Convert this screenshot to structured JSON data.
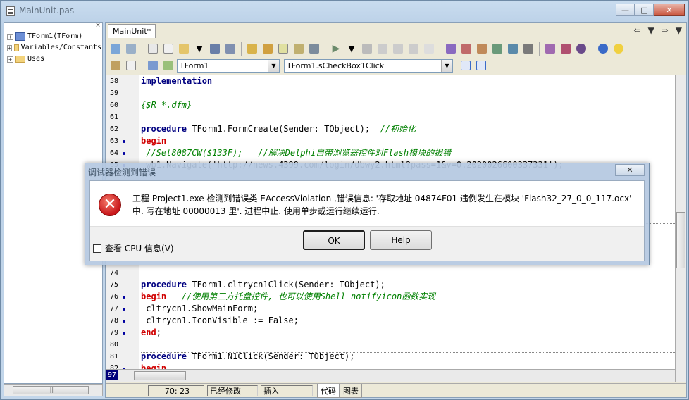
{
  "window": {
    "title": "MainUnit.pas"
  },
  "editor": {
    "tab_label": "MainUnit*"
  },
  "combos": {
    "form": "TForm1",
    "method": "TForm1.sCheckBox1Click"
  },
  "tree": [
    {
      "label": "TForm1(TForm)",
      "kind": "class"
    },
    {
      "label": "Variables/Constants",
      "kind": "folder"
    },
    {
      "label": "Uses",
      "kind": "folder"
    }
  ],
  "code_top": [
    {
      "n": "58",
      "bp": false,
      "parts": [
        [
          "kw",
          "implementation"
        ]
      ]
    },
    {
      "n": "59",
      "bp": false,
      "parts": []
    },
    {
      "n": "60",
      "bp": false,
      "parts": [
        [
          "cm",
          "{$R *.dfm}"
        ]
      ]
    },
    {
      "n": "61",
      "bp": false,
      "parts": []
    },
    {
      "n": "62",
      "bp": false,
      "parts": [
        [
          "kw",
          "procedure"
        ],
        [
          "",
          " TForm1.FormCreate(Sender: TObject);  "
        ],
        [
          "cm",
          "//初始化"
        ]
      ]
    },
    {
      "n": "63",
      "bp": true,
      "parts": [
        [
          "kw",
          "begin"
        ]
      ]
    },
    {
      "n": "64",
      "bp": true,
      "parts": [
        [
          "cm",
          " //Set8087CW($133F);   //解决Delphi自带浏览器控件对Flash模块的报错"
        ]
      ]
    },
    {
      "n": "65",
      "bp": true,
      "parts": [
        [
          "",
          " wb1.Navigate('http://news.4399.com/login/dbwy2.html?pass=1&v=0.2020026600337331');"
        ]
      ]
    }
  ],
  "code_bottom": [
    {
      "n": "74",
      "bp": false,
      "parts": []
    },
    {
      "n": "75",
      "bp": false,
      "parts": [
        [
          "kw",
          "procedure"
        ],
        [
          "",
          " TForm1.cltrycn1Click(Sender: TObject);"
        ]
      ]
    },
    {
      "n": "76",
      "bp": true,
      "parts": [
        [
          "kw",
          "begin"
        ],
        [
          "cm",
          "   //使用第三方托盘控件, 也可以使用Shell_notifyicon函数实现"
        ]
      ]
    },
    {
      "n": "77",
      "bp": true,
      "parts": [
        [
          "",
          " cltrycn1.ShowMainForm;"
        ]
      ]
    },
    {
      "n": "78",
      "bp": true,
      "parts": [
        [
          "",
          " cltrycn1.IconVisible := False;"
        ]
      ]
    },
    {
      "n": "79",
      "bp": true,
      "parts": [
        [
          "kw",
          "end"
        ],
        [
          "",
          ";"
        ]
      ]
    },
    {
      "n": "80",
      "bp": false,
      "parts": []
    },
    {
      "n": "81",
      "bp": false,
      "parts": [
        [
          "kw",
          "procedure"
        ],
        [
          "",
          " TForm1.N1Click(Sender: TObject);"
        ]
      ]
    },
    {
      "n": "82",
      "bp": true,
      "parts": [
        [
          "kw",
          "begin"
        ]
      ]
    }
  ],
  "editor_bottom": {
    "current_line": "97"
  },
  "status": {
    "position": "70: 23",
    "modified": "已经修改",
    "mode": "插入",
    "tab_code": "代码",
    "tab_diagram": "图表"
  },
  "dialog": {
    "title": "调试器检测到错误",
    "message": "工程 Project1.exe 检测到错误类 EAccessViolation ,错误信息: '存取地址 04874F01 违例发生在模块 'Flash32_27_0_0_117.ocx' 中. 写在地址 00000013 里'. 进程中止. 使用单步或运行继续运行.",
    "checkbox_label": "查看 CPU 信息(V)",
    "ok_label": "OK",
    "help_label": "Help"
  },
  "colors": {
    "keyword": "#000080",
    "comment": "#008000",
    "begin_marker": "#d00000"
  }
}
